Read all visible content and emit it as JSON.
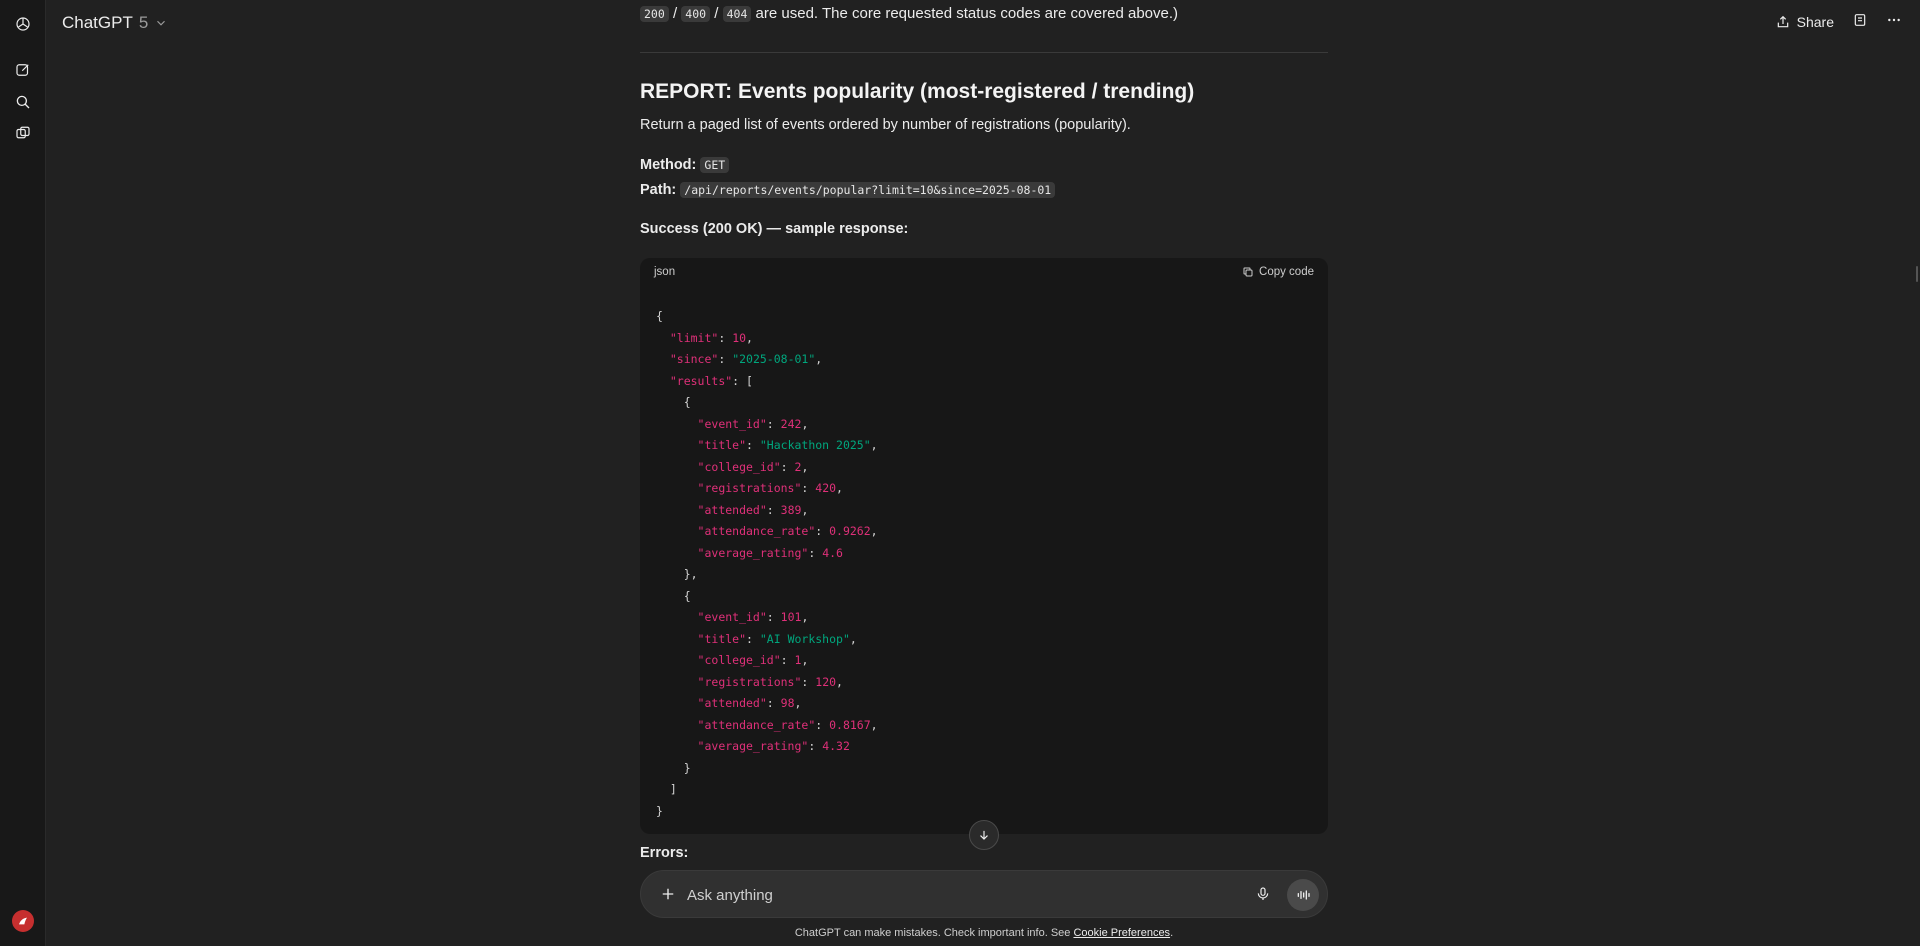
{
  "header": {
    "model_name": "ChatGPT",
    "model_version": "5",
    "share_label": "Share"
  },
  "previous_text": {
    "chips": [
      "200",
      "400",
      "404"
    ],
    "sep": "/",
    "tail": "are used. The core requested status codes are covered above.)"
  },
  "section": {
    "title": "REPORT: Events popularity (most-registered / trending)",
    "description": "Return a paged list of events ordered by number of registrations (popularity).",
    "method_label": "Method:",
    "method_value": "GET",
    "path_label": "Path:",
    "path_value": "/api/reports/events/popular?limit=10&since=2025-08-01",
    "success_label": "Success (200 OK) — sample response:",
    "errors_label": "Errors:"
  },
  "code_block": {
    "language": "json",
    "copy_label": "Copy code",
    "top": {
      "limit": "10",
      "since": "\"2025-08-01\""
    },
    "results": [
      {
        "event_id": "242",
        "title": "\"Hackathon 2025\"",
        "college_id": "2",
        "registrations": "420",
        "attended": "389",
        "attendance_rate": "0.9262",
        "average_rating": "4.6"
      },
      {
        "event_id": "101",
        "title": "\"AI Workshop\"",
        "college_id": "1",
        "registrations": "120",
        "attended": "98",
        "attendance_rate": "0.8167",
        "average_rating": "4.32"
      }
    ]
  },
  "composer": {
    "placeholder": "Ask anything"
  },
  "footer": {
    "text": "ChatGPT can make mistakes. Check important info. See",
    "link": "Cookie Preferences",
    "end": "."
  },
  "icons": {
    "logo": "openai-logo-icon",
    "new_chat": "new-chat-icon",
    "search": "search-icon",
    "library": "library-icon",
    "share": "share-icon",
    "notes": "notes-icon",
    "more": "more-icon"
  }
}
